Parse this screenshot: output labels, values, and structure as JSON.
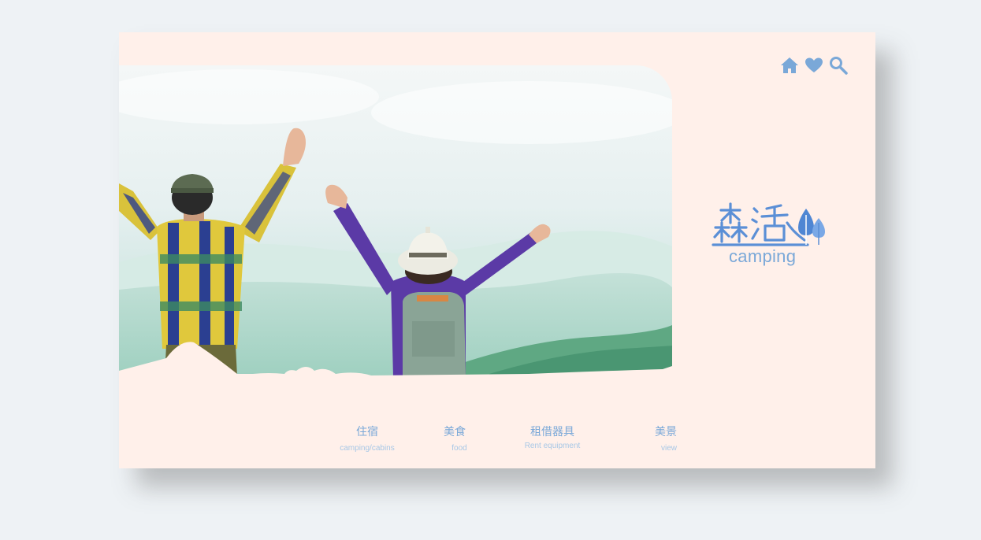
{
  "header": {
    "icons": [
      "home-icon",
      "heart-icon",
      "search-icon"
    ]
  },
  "logo": {
    "subtitle": "camping"
  },
  "nav": {
    "items": [
      {
        "label": "住宿",
        "sub": "camping/cabins"
      },
      {
        "label": "美食",
        "sub": "food"
      },
      {
        "label": "租借器具",
        "sub": "Rent equipment"
      },
      {
        "label": "美景",
        "sub": "view"
      }
    ]
  },
  "colors": {
    "page_bg": "#eef2f5",
    "card_bg": "#fff0ea",
    "accent": "#7aa8d8",
    "accent_light": "#a7c7e6",
    "logo_blue": "#5b8fd6"
  }
}
